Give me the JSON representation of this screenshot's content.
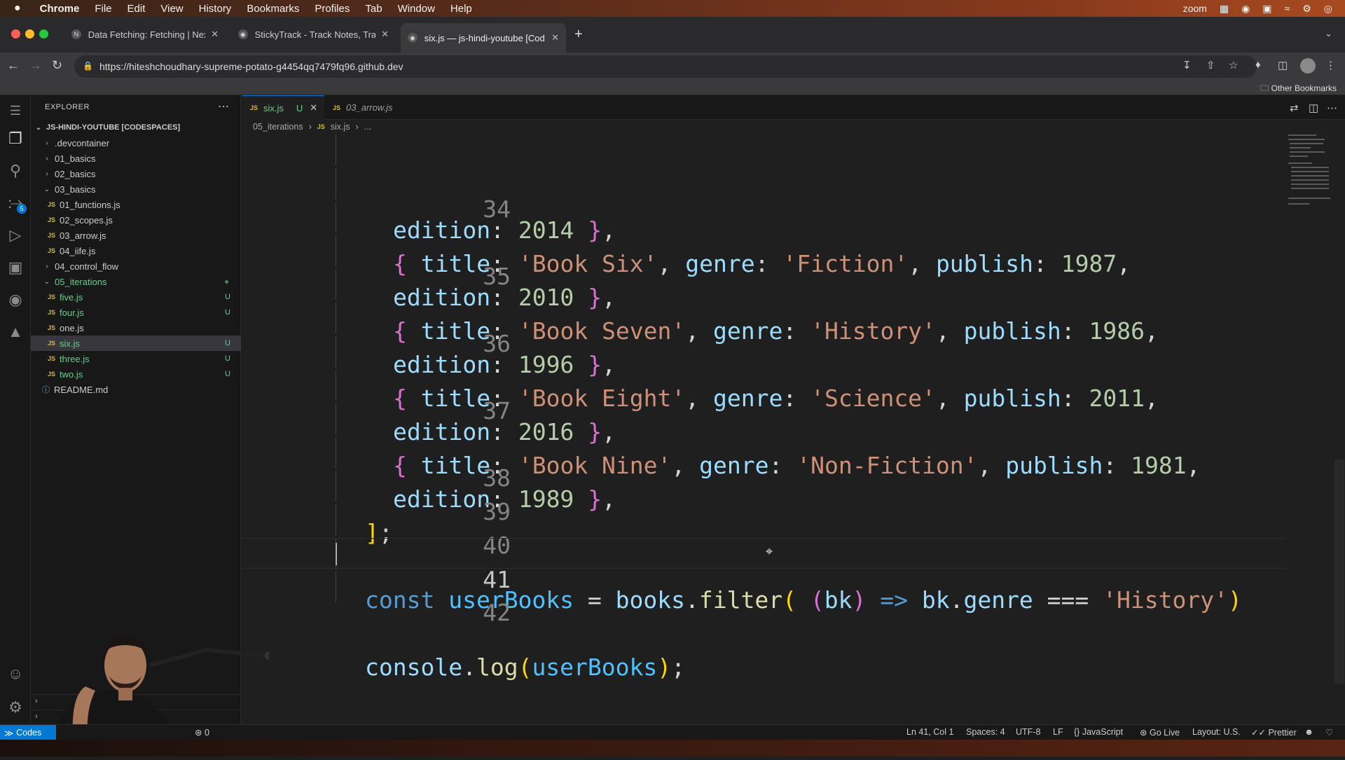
{
  "menubar": {
    "apple": "",
    "app": "Chrome",
    "items": [
      "File",
      "Edit",
      "View",
      "History",
      "Bookmarks",
      "Profiles",
      "Tab",
      "Window",
      "Help"
    ],
    "right_label": "zoom"
  },
  "browser": {
    "tabs": [
      {
        "label": "Data Fetching: Fetching | Next"
      },
      {
        "label": "StickyTrack - Track Notes, Trac"
      },
      {
        "label": "six.js — js-hindi-youtube [Cod"
      }
    ],
    "url": "https://hiteshchoudhary-supreme-potato-g4454qq7479fq96.github.dev",
    "other_bookmarks": "Other Bookmarks"
  },
  "explorer": {
    "title": "EXPLORER",
    "root": "JS-HINDI-YOUTUBE [CODESPACES]",
    "items": [
      {
        "label": ".devcontainer"
      },
      {
        "label": "01_basics"
      },
      {
        "label": "02_basics"
      },
      {
        "label": "03_basics"
      },
      {
        "label": "01_functions.js"
      },
      {
        "label": "02_scopes.js"
      },
      {
        "label": "03_arrow.js"
      },
      {
        "label": "04_iife.js"
      },
      {
        "label": "04_control_flow"
      },
      {
        "label": "05_iterations"
      },
      {
        "label": "five.js",
        "status": "U"
      },
      {
        "label": "four.js",
        "status": "U"
      },
      {
        "label": "one.js"
      },
      {
        "label": "six.js",
        "status": "U"
      },
      {
        "label": "three.js",
        "status": "U"
      },
      {
        "label": "two.js",
        "status": "U"
      },
      {
        "label": "README.md"
      }
    ],
    "scm_badge": "5"
  },
  "editor": {
    "tabs": [
      {
        "label": "six.js",
        "status": "U"
      },
      {
        "label": "03_arrow.js"
      }
    ],
    "breadcrumb": [
      "05_iterations",
      "six.js",
      "..."
    ],
    "lines": [
      {
        "n": "",
        "text": "edition: 2014 },"
      },
      {
        "n": "34",
        "text": "{ title: 'Book Six', genre: 'Fiction', publish: 1987,"
      },
      {
        "n": "",
        "text": "edition: 2010 },"
      },
      {
        "n": "35",
        "text": "{ title: 'Book Seven', genre: 'History', publish: 1986,"
      },
      {
        "n": "",
        "text": "edition: 1996 },"
      },
      {
        "n": "36",
        "text": "{ title: 'Book Eight', genre: 'Science', publish: 2011,"
      },
      {
        "n": "",
        "text": "edition: 2016 },"
      },
      {
        "n": "37",
        "text": "{ title: 'Book Nine', genre: 'Non-Fiction', publish: 1981,"
      },
      {
        "n": "",
        "text": "edition: 1989 },"
      },
      {
        "n": "38",
        "text": "];"
      },
      {
        "n": "39",
        "text": ""
      },
      {
        "n": "40",
        "text": "const userBooks = books.filter( (bk) => bk.genre === 'History')"
      },
      {
        "n": "41",
        "text": ""
      },
      {
        "n": "42",
        "text": "console.log(userBooks);"
      }
    ]
  },
  "statusbar": {
    "remote": "Codes",
    "problems": "0",
    "cursor": "Ln 41, Col 1",
    "spaces": "Spaces: 4",
    "encoding": "UTF-8",
    "eol": "LF",
    "language": "JavaScript",
    "golive": "Go Live",
    "layout": "Layout: U.S.",
    "prettier": "Prettier"
  }
}
